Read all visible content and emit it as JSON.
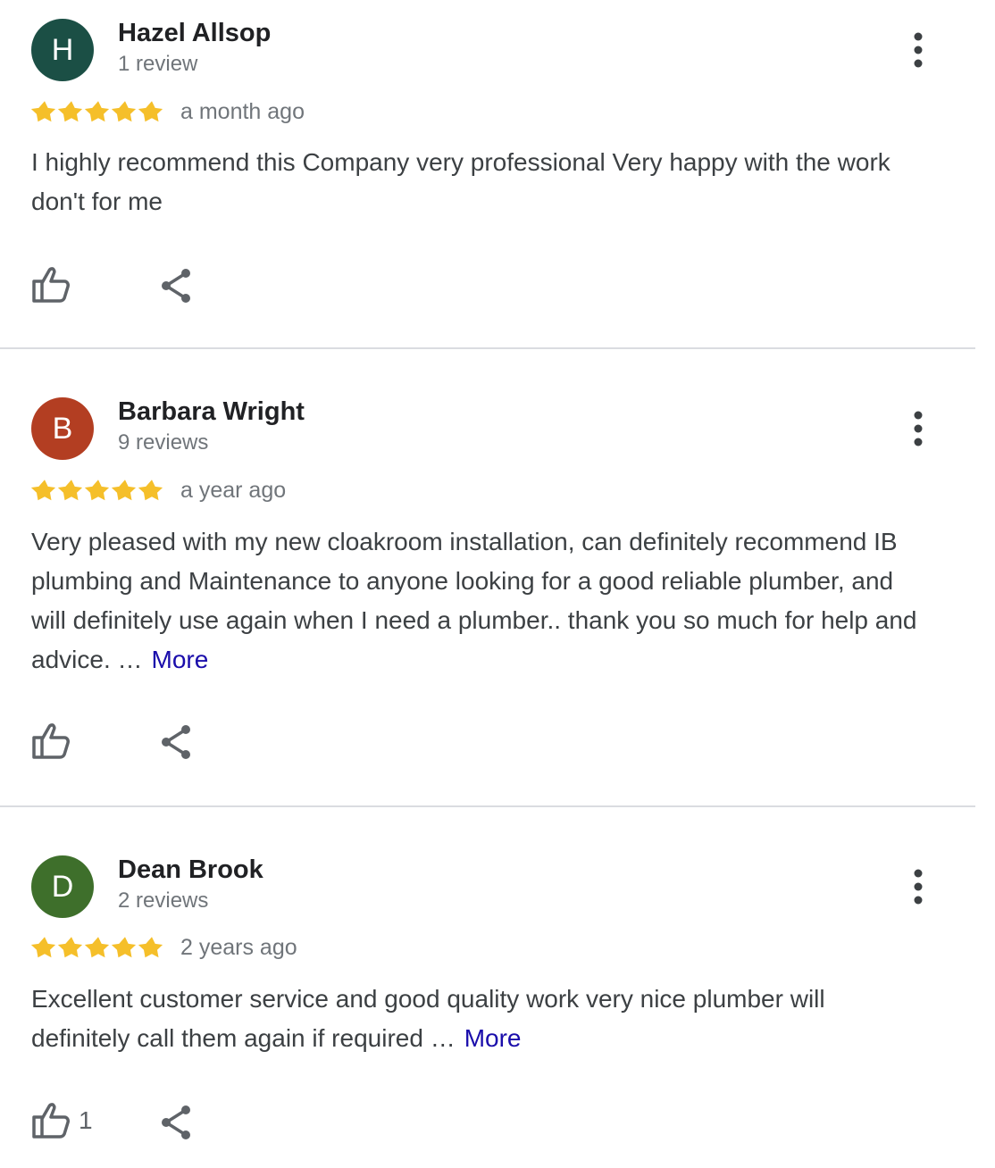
{
  "colors": {
    "star": "#F5BF2A",
    "link": "#1a0dab",
    "icon": "#5f6368"
  },
  "reviews": [
    {
      "initial": "H",
      "avatar_color": "#1B4F45",
      "name": "Hazel Allsop",
      "review_count": "1 review",
      "rating": 5,
      "time": "a month ago",
      "text": "I highly recommend this Company very professional Very happy with the work don't for me",
      "more_label": "",
      "likes": ""
    },
    {
      "initial": "B",
      "avatar_color": "#B33E22",
      "name": "Barbara Wright",
      "review_count": "9 reviews",
      "rating": 5,
      "time": "a year ago",
      "text": "Very pleased with my new cloakroom installation, can definitely recommend IB plumbing and Maintenance to anyone looking for a good reliable plumber, and will definitely use again when I need a plumber.. thank you so much for help and advice. …",
      "more_label": "More",
      "likes": ""
    },
    {
      "initial": "D",
      "avatar_color": "#3E6F2B",
      "name": "Dean Brook",
      "review_count": "2 reviews",
      "rating": 5,
      "time": "2 years ago",
      "text": "Excellent customer service and good quality work very nice plumber will definitely call them again if required …",
      "more_label": "More",
      "likes": "1"
    }
  ]
}
